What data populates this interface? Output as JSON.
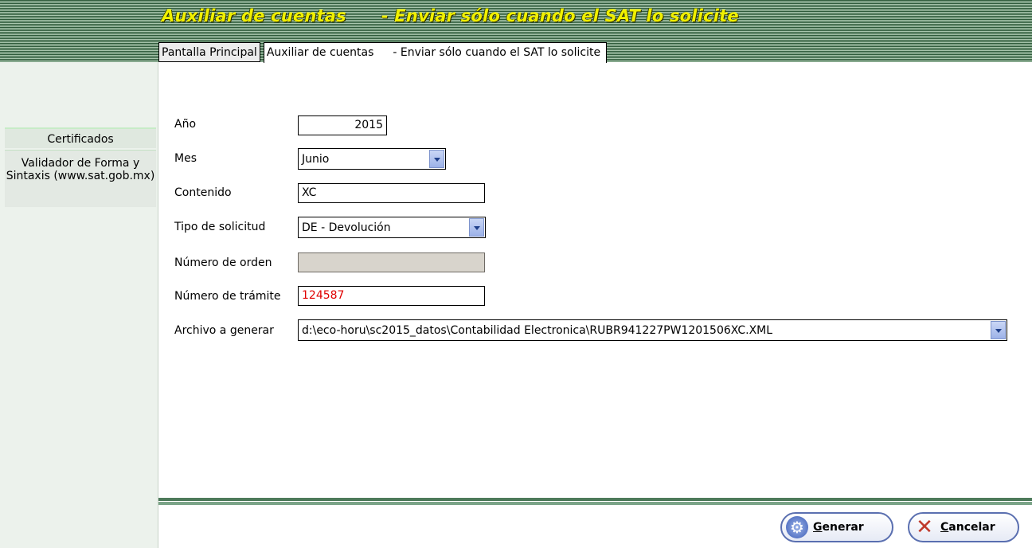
{
  "window": {
    "title_left": "Auxiliar de cuentas",
    "title_right": "- Enviar sólo cuando el SAT lo solicite"
  },
  "tabs": [
    {
      "label": "Pantalla Principal"
    },
    {
      "label": "Auxiliar de cuentas",
      "label2": "- Enviar sólo cuando el SAT lo solicite"
    }
  ],
  "sidebar": {
    "items": [
      {
        "label": "Certificados"
      },
      {
        "label": "Validador de Forma y Sintaxis (www.sat.gob.mx)"
      }
    ]
  },
  "form": {
    "anio": {
      "label": "Año",
      "value": "2015"
    },
    "mes": {
      "label": "Mes",
      "value": "Junio"
    },
    "contenido": {
      "label": "Contenido",
      "value": "XC"
    },
    "tipo": {
      "label": "Tipo de solicitud",
      "value": "DE - Devolución"
    },
    "orden": {
      "label": "Número de orden",
      "value": ""
    },
    "tramite": {
      "label": "Número de trámite",
      "value": "124587"
    },
    "archivo": {
      "label": "Archivo a generar",
      "value": "d:\\eco-horu\\sc2015_datos\\Contabilidad Electronica\\RUBR941227PW1201506XC.XML"
    }
  },
  "buttons": {
    "generar": "Generar",
    "cancelar": "Cancelar"
  },
  "colors": {
    "title": "#f0f000",
    "tramite_text": "#e00000",
    "separator": "#4d7a5a"
  }
}
